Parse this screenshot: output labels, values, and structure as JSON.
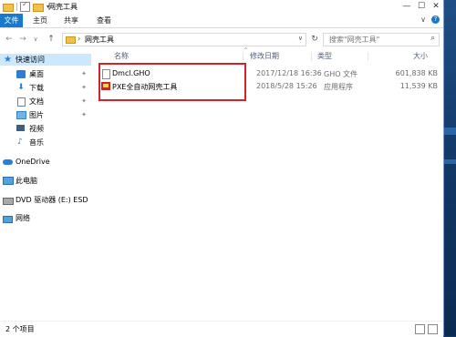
{
  "window": {
    "title": "网壳工具",
    "controls": {
      "minimize": "—",
      "maximize": "☐",
      "close": "✕"
    }
  },
  "ribbon": {
    "tabs": [
      {
        "label": "文件"
      },
      {
        "label": "主页"
      },
      {
        "label": "共享"
      },
      {
        "label": "查看"
      }
    ],
    "expand_glyph": "∨",
    "help_glyph": "?"
  },
  "address": {
    "back": "←",
    "forward": "→",
    "recent": "∨",
    "up": "↑",
    "path_sep": "›",
    "path": "网壳工具",
    "dropdown": "∨",
    "refresh": "↻",
    "search_placeholder": "搜索\"网壳工具\"",
    "search_glyph": "⌕"
  },
  "sidebar": {
    "items": [
      {
        "label": "快速访问",
        "icon": "star-icon",
        "pinned": false
      },
      {
        "label": "桌面",
        "icon": "desktop-icon",
        "pinned": true
      },
      {
        "label": "下载",
        "icon": "download-icon",
        "pinned": true
      },
      {
        "label": "文档",
        "icon": "document-icon",
        "pinned": true
      },
      {
        "label": "图片",
        "icon": "picture-icon",
        "pinned": true
      },
      {
        "label": "视频",
        "icon": "video-icon",
        "pinned": false
      },
      {
        "label": "音乐",
        "icon": "music-icon",
        "pinned": false
      },
      {
        "label": "OneDrive",
        "icon": "cloud-icon",
        "pinned": false
      },
      {
        "label": "此电脑",
        "icon": "computer-icon",
        "pinned": false
      },
      {
        "label": "DVD 驱动器 (E:) ESD",
        "icon": "dvd-icon",
        "pinned": false
      },
      {
        "label": "网络",
        "icon": "network-icon",
        "pinned": false
      }
    ],
    "pin_glyph": "✦"
  },
  "columns": {
    "name": "名称",
    "date": "修改日期",
    "type": "类型",
    "size": "大小"
  },
  "files": [
    {
      "name": "Dmcl.GHO",
      "date": "2017/12/18 16:36",
      "type": "GHO 文件",
      "size": "601,838 KB",
      "icon": "file-icon"
    },
    {
      "name": "PXE全自动网壳工具",
      "date": "2018/5/28 15:26",
      "type": "应用程序",
      "size": "11,539 KB",
      "icon": "app-icon"
    }
  ],
  "status": {
    "item_count": "2 个项目"
  }
}
